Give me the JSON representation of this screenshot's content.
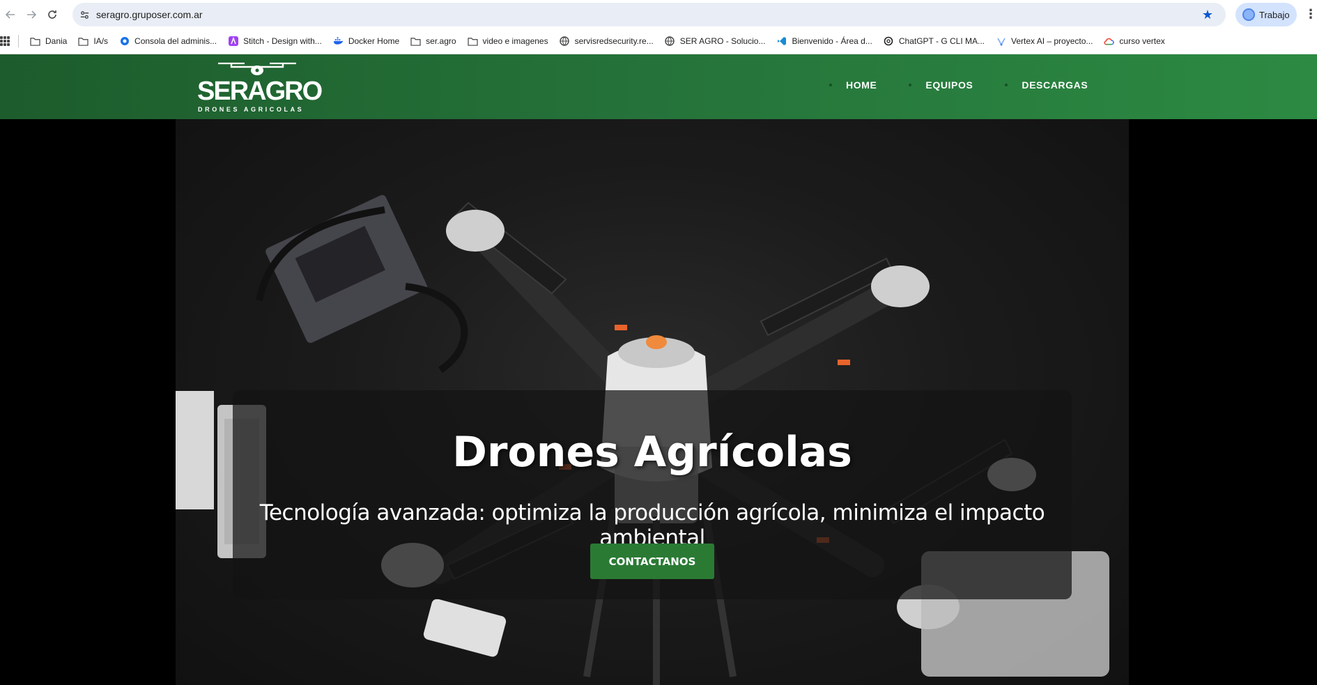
{
  "browser": {
    "url": "seragro.gruposer.com.ar",
    "profile_label": "Trabajo",
    "accent": "#0b57d0"
  },
  "bookmarks": [
    {
      "label": "Dania",
      "icon": "folder-icon"
    },
    {
      "label": "IA/s",
      "icon": "folder-icon"
    },
    {
      "label": "Consola del adminis...",
      "icon": "admin-console-icon"
    },
    {
      "label": "Stitch - Design with...",
      "icon": "stitch-icon"
    },
    {
      "label": "Docker Home",
      "icon": "docker-icon"
    },
    {
      "label": "ser.agro",
      "icon": "folder-icon"
    },
    {
      "label": "video e imagenes",
      "icon": "folder-icon"
    },
    {
      "label": "servisredsecurity.re...",
      "icon": "globe-icon"
    },
    {
      "label": "SER AGRO - Solucio...",
      "icon": "globe-icon"
    },
    {
      "label": "Bienvenido - Área d...",
      "icon": "vscode-icon"
    },
    {
      "label": "ChatGPT - G CLI MA...",
      "icon": "chatgpt-icon"
    },
    {
      "label": "Vertex AI – proyecto...",
      "icon": "vertex-icon"
    },
    {
      "label": "curso vertex",
      "icon": "google-cloud-icon"
    }
  ],
  "site": {
    "logo": {
      "brand": "SERAGRO",
      "tagline": "DRONES AGRICOLAS"
    },
    "nav": [
      {
        "label": "HOME"
      },
      {
        "label": "EQUIPOS"
      },
      {
        "label": "DESCARGAS"
      }
    ],
    "hero": {
      "title": "Drones Agrícolas",
      "subtitle": "Tecnología avanzada: optimiza la producción agrícola, minimiza el impacto ambiental",
      "cta_label": "CONTACTANOS"
    },
    "colors": {
      "header_green": "#25733a",
      "cta_green": "#2a7a34"
    }
  }
}
